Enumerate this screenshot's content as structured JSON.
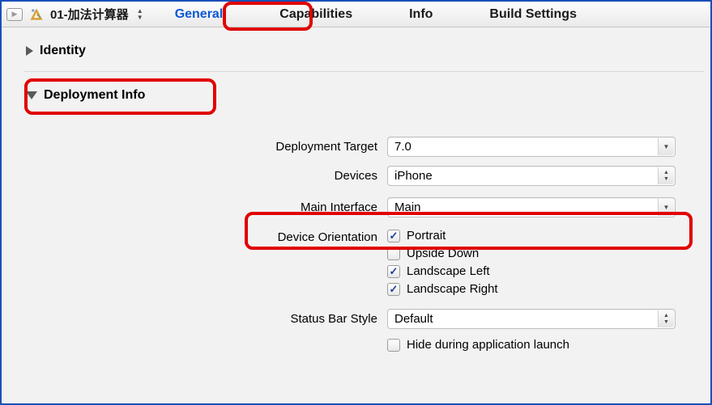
{
  "header": {
    "target_name": "01-加法计算器",
    "tabs": {
      "general": "General",
      "capabilities": "Capabilities",
      "info": "Info",
      "build_settings": "Build Settings"
    }
  },
  "sections": {
    "identity": {
      "title": "Identity"
    },
    "deployment": {
      "title": "Deployment Info",
      "labels": {
        "deployment_target": "Deployment Target",
        "devices": "Devices",
        "main_interface": "Main Interface",
        "device_orientation": "Device Orientation",
        "status_bar_style": "Status Bar Style"
      },
      "deployment_target_value": "7.0",
      "devices_value": "iPhone",
      "main_interface_value": "Main",
      "orientation": {
        "portrait": {
          "label": "Portrait",
          "checked": true
        },
        "upside_down": {
          "label": "Upside Down",
          "checked": false
        },
        "landscape_left": {
          "label": "Landscape Left",
          "checked": true
        },
        "landscape_right": {
          "label": "Landscape Right",
          "checked": true
        }
      },
      "status_bar_value": "Default",
      "hide_label": "Hide during application launch",
      "hide_checked": false
    }
  }
}
